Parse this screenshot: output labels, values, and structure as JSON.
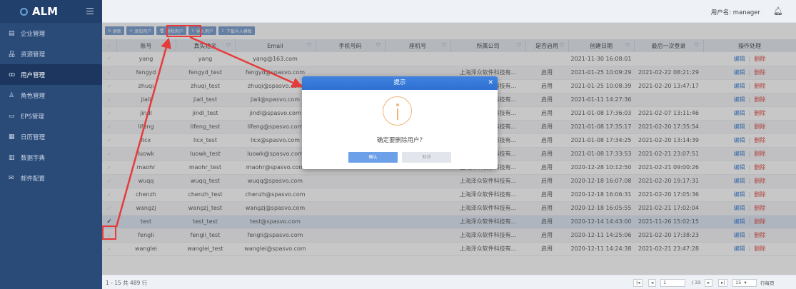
{
  "app": {
    "logo_text": "ALM",
    "user_label": "用户名: manager"
  },
  "sidebar": {
    "items": [
      {
        "label": "企业管理",
        "icon": "building-icon",
        "glyph": "▤"
      },
      {
        "label": "资源管理",
        "icon": "org-icon",
        "glyph": "品"
      },
      {
        "label": "用户管理",
        "icon": "users-icon",
        "glyph": "ꝏ",
        "active": true
      },
      {
        "label": "角色管理",
        "icon": "person-icon",
        "glyph": "♙"
      },
      {
        "label": "EPS管理",
        "icon": "folder-icon",
        "glyph": "▭"
      },
      {
        "label": "日历管理",
        "icon": "calendar-icon",
        "glyph": "▦"
      },
      {
        "label": "数据字典",
        "icon": "book-icon",
        "glyph": "▥"
      },
      {
        "label": "邮件配置",
        "icon": "mail-icon",
        "glyph": "✉"
      }
    ]
  },
  "toolbar": {
    "refresh": "刷新",
    "add_user": "添加用户",
    "delete_user": "删除用户",
    "import_user": "导入用户",
    "download_template": "下载导入模板"
  },
  "table": {
    "headers": [
      "账号",
      "真实姓名",
      "Email",
      "手机号码",
      "座机号",
      "所属公司",
      "是否启用",
      "创建日期",
      "最后一次登录",
      "操作处理"
    ],
    "rows": [
      {
        "account": "yang",
        "real_name": "yang",
        "email": "yang@163.com",
        "mobile": "",
        "phone": "",
        "company": "",
        "enabled": "",
        "created": "2021-11-30 16:08:01",
        "last_login": "",
        "selected": false
      },
      {
        "account": "fengyd",
        "real_name": "fengyd_test",
        "email": "fengyd@spasvo.com",
        "mobile": "",
        "phone": "",
        "company": "上海泽众软件科技有...",
        "enabled": "启用",
        "created": "2021-01-25 10:09:29",
        "last_login": "2021-02-22 08:21:29",
        "selected": false
      },
      {
        "account": "zhuqi",
        "real_name": "zhuqi_test",
        "email": "zhuqi@spasvo.com",
        "mobile": "",
        "phone": "",
        "company": "上海泽众软件科技有...",
        "enabled": "启用",
        "created": "2021-01-25 10:08:39",
        "last_login": "2021-02-20 13:47:17",
        "selected": false
      },
      {
        "account": "jiali",
        "real_name": "jiali_test",
        "email": "jiali@spasvo.com",
        "mobile": "",
        "phone": "",
        "company": "上海泽众软件科技有...",
        "enabled": "启用",
        "created": "2021-01-11 14:27:36",
        "last_login": "",
        "selected": false
      },
      {
        "account": "jindl",
        "real_name": "jindl_test",
        "email": "jindl@spasvo.com",
        "mobile": "",
        "phone": "",
        "company": "上海泽众软件科技有...",
        "enabled": "启用",
        "created": "2021-01-08 17:36:03",
        "last_login": "2021-02-07 13:11:46",
        "selected": false
      },
      {
        "account": "lifeng",
        "real_name": "lifeng_test",
        "email": "lifeng@spasvo.com",
        "mobile": "",
        "phone": "",
        "company": "上海泽众软件科技有...",
        "enabled": "启用",
        "created": "2021-01-08 17:35:17",
        "last_login": "2021-02-20 17:35:54",
        "selected": false
      },
      {
        "account": "licx",
        "real_name": "licx_test",
        "email": "licx@spasvo.com",
        "mobile": "",
        "phone": "",
        "company": "上海泽众软件科技有...",
        "enabled": "启用",
        "created": "2021-01-08 17:34:25",
        "last_login": "2021-02-20 13:14:39",
        "selected": false
      },
      {
        "account": "luowk",
        "real_name": "luowk_test",
        "email": "luowk@spasvo.com",
        "mobile": "",
        "phone": "",
        "company": "上海泽众软件科技有...",
        "enabled": "启用",
        "created": "2021-01-08 17:33:53",
        "last_login": "2021-02-21 23:07:51",
        "selected": false
      },
      {
        "account": "maohr",
        "real_name": "maohr_test",
        "email": "maohr@spasvo.com",
        "mobile": "",
        "phone": "",
        "company": "上海泽众软件科技有...",
        "enabled": "启用",
        "created": "2020-12-28 10:12:50",
        "last_login": "2021-02-21 09:00:26",
        "selected": false
      },
      {
        "account": "wuqq",
        "real_name": "wuqq_test",
        "email": "wuqq@spasvo.com",
        "mobile": "",
        "phone": "",
        "company": "上海泽众软件科技有...",
        "enabled": "启用",
        "created": "2020-12-18 16:07:08",
        "last_login": "2021-02-20 19:17:31",
        "selected": false
      },
      {
        "account": "chenzh",
        "real_name": "chenzh_test",
        "email": "chenzh@spasvo.com",
        "mobile": "",
        "phone": "",
        "company": "上海泽众软件科技有...",
        "enabled": "启用",
        "created": "2020-12-18 16:06:31",
        "last_login": "2021-02-20 17:05:36",
        "selected": false
      },
      {
        "account": "wangzj",
        "real_name": "wangzj_test",
        "email": "wangzj@spasvo.com",
        "mobile": "",
        "phone": "",
        "company": "上海泽众软件科技有...",
        "enabled": "启用",
        "created": "2020-12-18 16:05:55",
        "last_login": "2021-02-21 17:02:04",
        "selected": false
      },
      {
        "account": "test",
        "real_name": "test_test",
        "email": "test@spasvo.com",
        "mobile": "",
        "phone": "",
        "company": "上海泽众软件科技有...",
        "enabled": "启用",
        "created": "2020-12-14 14:43:00",
        "last_login": "2021-11-26 15:02:15",
        "selected": true
      },
      {
        "account": "fengli",
        "real_name": "fengli_test",
        "email": "fengli@spasvo.com",
        "mobile": "",
        "phone": "",
        "company": "上海泽众软件科技有...",
        "enabled": "启用",
        "created": "2020-12-11 14:25:06",
        "last_login": "2021-02-20 17:38:23",
        "selected": false
      },
      {
        "account": "wanglei",
        "real_name": "wanglei_test",
        "email": "wanglei@spasvo.com",
        "mobile": "",
        "phone": "",
        "company": "上海泽众软件科技有...",
        "enabled": "启用",
        "created": "2020-12-11 14:24:38",
        "last_login": "2021-02-21 23:47:28",
        "selected": false
      }
    ],
    "actions": {
      "edit": "编辑",
      "delete": "删除"
    }
  },
  "pager": {
    "summary": "1 - 15 共 489 行",
    "current_page": "1",
    "total_pages": "/ 33",
    "page_size": "15",
    "per_page_label": "行每页"
  },
  "dialog": {
    "title": "提示",
    "message": "确定要删除用户?",
    "confirm": "确认",
    "cancel": "取消"
  },
  "annotation_color": "#e53b3b"
}
